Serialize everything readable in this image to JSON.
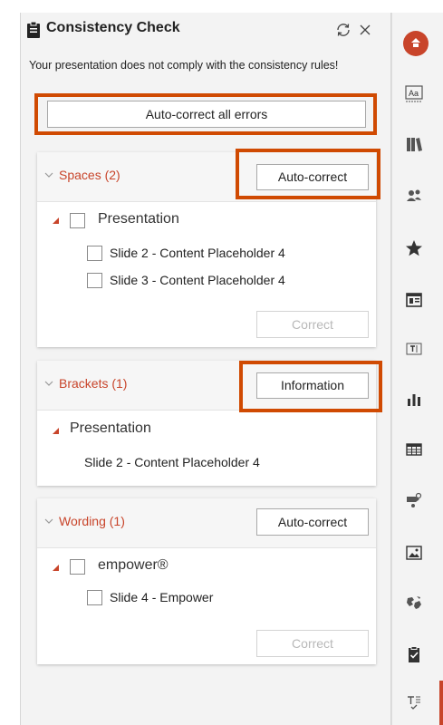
{
  "header": {
    "title": "Consistency Check",
    "subtitle": "Your presentation does not comply with the consistency rules!",
    "auto_correct_all_label": "Auto-correct all errors"
  },
  "sections": [
    {
      "title": "Spaces (2)",
      "action_label": "Auto-correct",
      "tree_root": "Presentation",
      "items": [
        "Slide 2 - Content Placeholder 4",
        "Slide 3 - Content Placeholder 4"
      ],
      "correct_label": "Correct"
    },
    {
      "title": "Brackets (1)",
      "action_label": "Information",
      "tree_root": "Presentation",
      "items": [
        "Slide 2 - Content Placeholder 4"
      ]
    },
    {
      "title": "Wording (1)",
      "action_label": "Auto-correct",
      "tree_root": "empower®",
      "items": [
        "Slide 4 - Empower"
      ],
      "correct_label": "Correct"
    }
  ],
  "sidebar": {
    "icons": [
      "empower-logo-icon",
      "text-style-icon",
      "library-icon",
      "people-icon",
      "star-icon",
      "slide-layout-icon",
      "text-box-icon",
      "chart-icon",
      "table-icon",
      "smart-shapes-icon",
      "image-icon",
      "map-icon",
      "clipboard-check-icon",
      "consistency-check-icon"
    ]
  },
  "colors": {
    "accent": "#c8442a",
    "highlight": "#d04a02",
    "panel_bg": "#f3f3f3"
  }
}
